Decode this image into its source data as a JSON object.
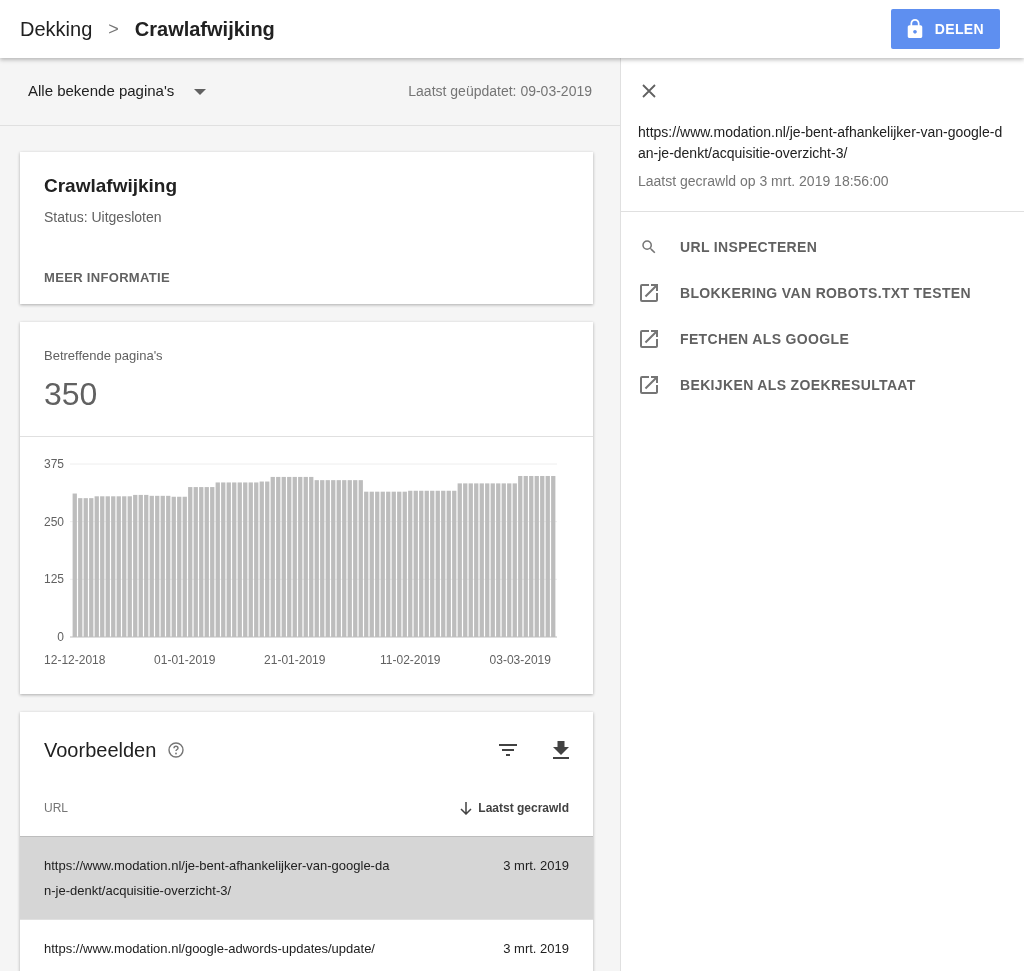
{
  "header": {
    "breadcrumb": [
      {
        "label": "Dekking",
        "current": false
      },
      {
        "label": "Crawlafwijking",
        "current": true
      }
    ],
    "separator": ">",
    "share_button": "DELEN"
  },
  "filter_bar": {
    "dropdown": "Alle bekende pagina's",
    "updated": "Laatst geüpdatet: 09-03-2019"
  },
  "status_card": {
    "title": "Crawlafwijking",
    "status": "Status: Uitgesloten",
    "link": "MEER INFORMATIE"
  },
  "pages_card": {
    "label": "Betreffende pagina's",
    "count": "350",
    "chart_data": {
      "type": "bar",
      "categories": [
        "12-12-2018",
        null,
        null,
        null,
        null,
        null,
        null,
        null,
        null,
        null,
        null,
        null,
        null,
        null,
        null,
        null,
        null,
        null,
        null,
        null,
        "01-01-2019",
        null,
        null,
        null,
        null,
        null,
        null,
        null,
        null,
        null,
        null,
        null,
        null,
        null,
        null,
        null,
        null,
        null,
        null,
        null,
        "21-01-2019",
        null,
        null,
        null,
        null,
        null,
        null,
        null,
        null,
        null,
        null,
        null,
        null,
        null,
        null,
        null,
        null,
        null,
        null,
        null,
        null,
        "11-02-2019",
        null,
        null,
        null,
        null,
        null,
        null,
        null,
        null,
        null,
        null,
        null,
        null,
        null,
        null,
        null,
        null,
        null,
        null,
        null,
        "03-03-2019",
        null,
        null,
        null,
        null,
        null,
        null
      ],
      "values": [
        311,
        301,
        301,
        301,
        305,
        305,
        305,
        305,
        305,
        305,
        305,
        308,
        308,
        308,
        306,
        306,
        306,
        306,
        304,
        304,
        304,
        325,
        325,
        325,
        325,
        325,
        335,
        335,
        335,
        335,
        335,
        335,
        335,
        335,
        337,
        337,
        347,
        347,
        347,
        347,
        347,
        347,
        347,
        347,
        340,
        340,
        340,
        340,
        340,
        340,
        340,
        340,
        340,
        315,
        315,
        315,
        315,
        315,
        315,
        315,
        315,
        317,
        317,
        317,
        317,
        317,
        317,
        317,
        317,
        317,
        333,
        333,
        333,
        333,
        333,
        333,
        333,
        333,
        333,
        333,
        333,
        349,
        349,
        349,
        349,
        349,
        349,
        349
      ],
      "ylim": [
        0,
        375
      ],
      "yticks": [
        0,
        125,
        250,
        375
      ]
    }
  },
  "examples": {
    "title": "Voorbeelden",
    "columns": [
      "URL",
      "Laatst gecrawld"
    ],
    "rows": [
      {
        "url": "https://www.modation.nl/je-bent-afhankelijker-van-google-dan-je-denkt/acquisitie-overzicht-3/",
        "date": "3 mrt. 2019",
        "selected": true
      },
      {
        "url": "https://www.modation.nl/google-adwords-updates/update/",
        "date": "3 mrt. 2019",
        "selected": false
      }
    ]
  },
  "detail_panel": {
    "url": "https://www.modation.nl/je-bent-afhankelijker-van-google-dan-je-denkt/acquisitie-overzicht-3/",
    "crawled": "Laatst gecrawld op 3 mrt. 2019 18:56:00",
    "actions": [
      {
        "kind": "search",
        "label": "URL INSPECTEREN"
      },
      {
        "kind": "external",
        "label": "BLOKKERING VAN ROBOTS.TXT TESTEN"
      },
      {
        "kind": "external",
        "label": "FETCHEN ALS GOOGLE"
      },
      {
        "kind": "external",
        "label": "BEKIJKEN ALS ZOEKRESULTAAT"
      }
    ]
  }
}
